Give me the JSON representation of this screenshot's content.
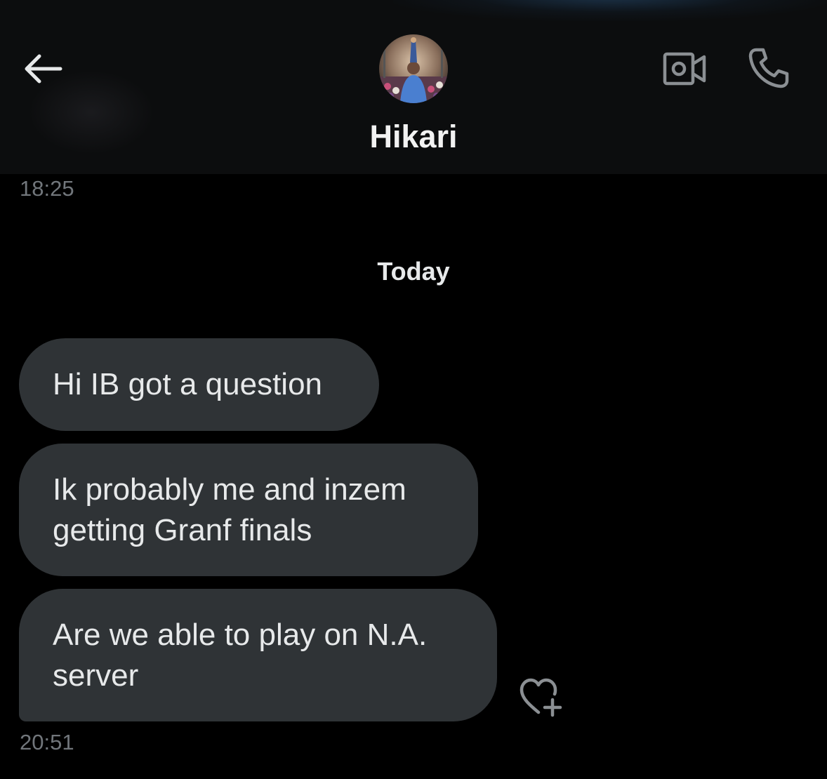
{
  "header": {
    "contact_name": "Hikari",
    "back_icon": "arrow-left-icon",
    "video_icon": "video-camera-icon",
    "phone_icon": "phone-icon"
  },
  "conversation": {
    "earlier_timestamp": "18:25",
    "day_divider": "Today",
    "messages": [
      {
        "text": "Hi IB got a question"
      },
      {
        "text": "Ik probably me and inzem getting Granf finals"
      },
      {
        "text": "Are we able to play on N.A. server"
      }
    ],
    "last_timestamp": "20:51",
    "reaction_icon": "heart-plus-icon"
  },
  "colors": {
    "background": "#000000",
    "header_background": "#0c0d0e",
    "bubble": "#2f3336",
    "text_primary": "#e7e9ea",
    "text_secondary": "#71767b"
  }
}
